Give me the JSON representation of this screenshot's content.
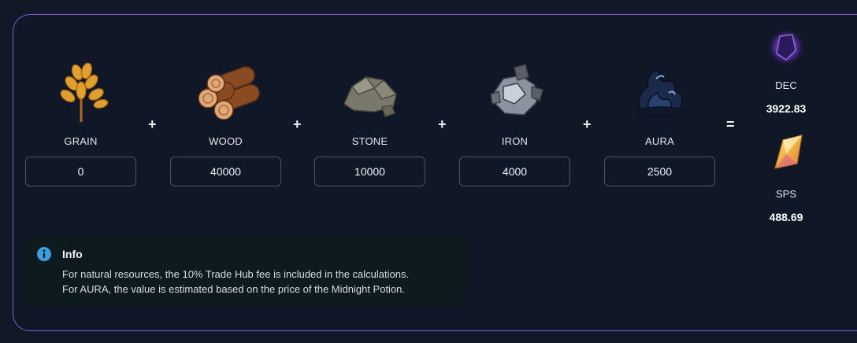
{
  "resources": [
    {
      "name": "GRAIN",
      "value": "0",
      "icon": "grain-icon"
    },
    {
      "name": "WOOD",
      "value": "40000",
      "icon": "wood-icon"
    },
    {
      "name": "STONE",
      "value": "10000",
      "icon": "stone-icon"
    },
    {
      "name": "IRON",
      "value": "4000",
      "icon": "iron-icon"
    },
    {
      "name": "AURA",
      "value": "2500",
      "icon": "aura-icon"
    }
  ],
  "operators": {
    "plus": "+",
    "equals": "="
  },
  "outputs": [
    {
      "name": "DEC",
      "value": "3922.83",
      "icon": "dec-icon"
    },
    {
      "name": "SPS",
      "value": "488.69",
      "icon": "sps-icon"
    }
  ],
  "info": {
    "title": "Info",
    "lines": [
      "For natural resources, the 10% Trade Hub fee is included in the calculations.",
      "For AURA, the value is estimated based on the price of the Midnight Potion."
    ]
  },
  "colors": {
    "background": "#111827",
    "panel_border": "#7c5fd6",
    "info_background": "#0d1a1e",
    "info_icon": "#3b9ede"
  }
}
